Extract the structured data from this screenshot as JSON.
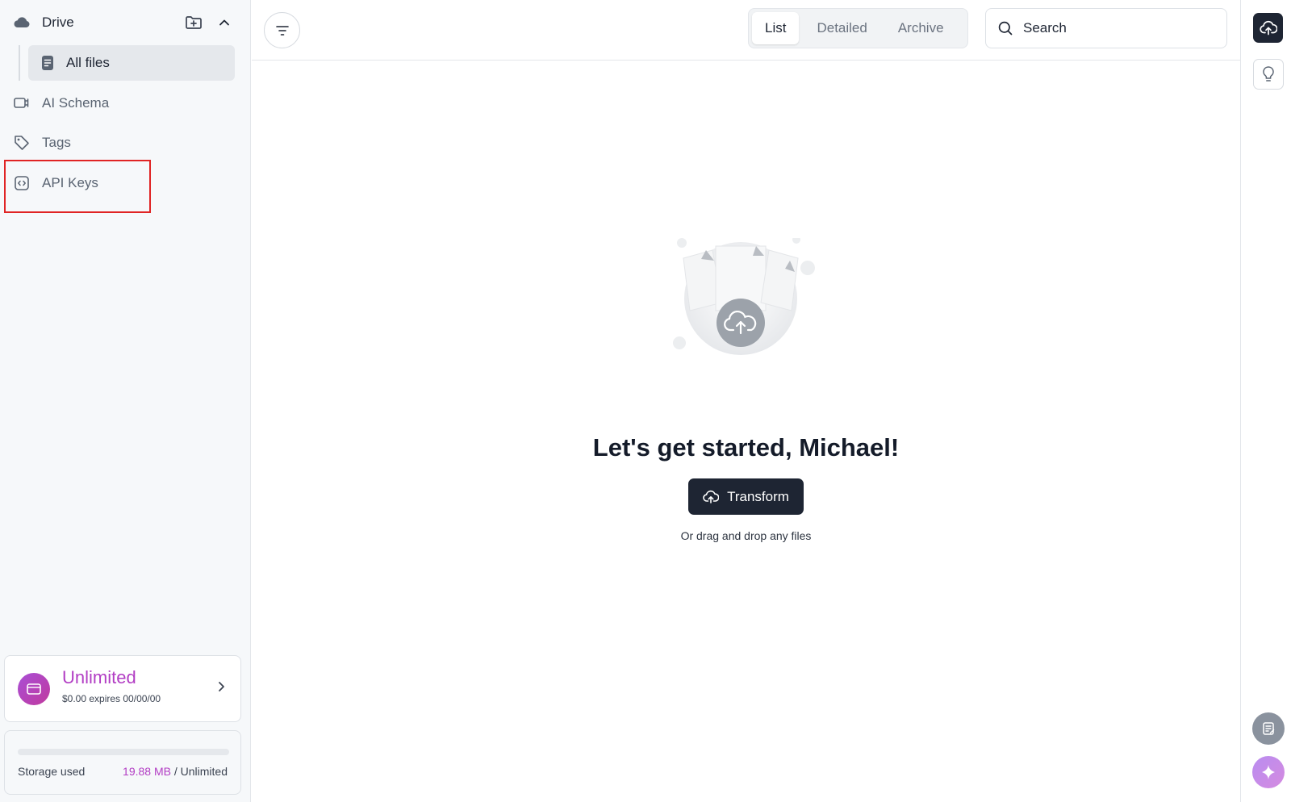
{
  "sidebar": {
    "drive_label": "Drive",
    "all_files_label": "All files",
    "items": [
      {
        "label": "AI Schema"
      },
      {
        "label": "Tags"
      },
      {
        "label": "API Keys"
      }
    ],
    "plan": {
      "name": "Unlimited",
      "details": "$0.00 expires 00/00/00"
    },
    "storage": {
      "label": "Storage used",
      "used": "19.88 MB",
      "limit": " / Unlimited",
      "fraction_used": 0
    }
  },
  "toolbar": {
    "view_tabs": [
      {
        "label": "List",
        "active": true
      },
      {
        "label": "Detailed",
        "active": false
      },
      {
        "label": "Archive",
        "active": false
      }
    ],
    "search_placeholder": "Search"
  },
  "empty_state": {
    "headline": "Let's get started, Michael!",
    "button_label": "Transform",
    "hint": "Or drag and drop any files"
  },
  "colors": {
    "accent": "#b23dc4",
    "dark": "#1e2533",
    "highlight": "#e02424"
  },
  "icons": {
    "drive": "cloud-icon",
    "new_folder": "folder-plus-icon",
    "collapse": "chevron-up-icon",
    "all_files": "document-icon",
    "ai_schema": "schema-icon",
    "tags": "tag-icon",
    "api_keys": "code-square-icon",
    "plan": "wallet-icon",
    "filter": "filter-icon",
    "search": "search-icon",
    "upload": "cloud-upload-icon",
    "idea": "lightbulb-icon",
    "notes": "notes-icon",
    "ai": "sparkle-icon"
  }
}
